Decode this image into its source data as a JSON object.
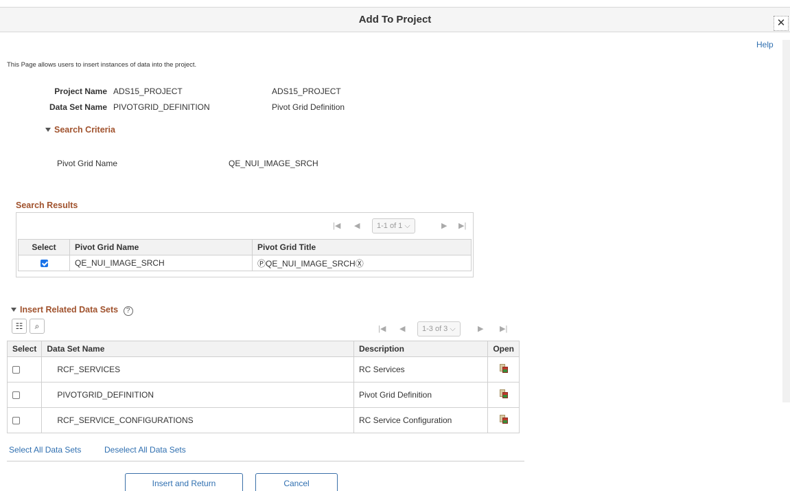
{
  "dialog": {
    "title": "Add To Project",
    "close_label": "✕"
  },
  "help_label": "Help",
  "intro": "This Page allows users to insert instances of data into the project.",
  "fields": {
    "project_label": "Project Name",
    "project_value": "ADS15_PROJECT",
    "project_desc": "ADS15_PROJECT",
    "dataset_label": "Data Set Name",
    "dataset_value": "PIVOTGRID_DEFINITION",
    "dataset_desc": "Pivot Grid Definition"
  },
  "search_criteria": {
    "header": "Search Criteria",
    "field_label": "Pivot Grid Name",
    "field_value": "QE_NUI_IMAGE_SRCH"
  },
  "search_results": {
    "header": "Search Results",
    "pager": {
      "first": "|◀",
      "prev": "◀",
      "label": "1-1 of 1",
      "next": "▶",
      "last": "▶|"
    },
    "columns": [
      "Select",
      "Pivot Grid Name",
      "Pivot Grid Title"
    ],
    "rows": [
      {
        "checked": true,
        "name": "QE_NUI_IMAGE_SRCH",
        "title": "ⓅQE_NUI_IMAGE_SRCHⓍ"
      }
    ]
  },
  "related": {
    "header": "Insert Related Data Sets",
    "help_icon": "?",
    "pager": {
      "first": "|◀",
      "prev": "◀",
      "label": "1-3 of 3",
      "next": "▶",
      "last": "▶|"
    },
    "columns": [
      "Select",
      "Data Set Name",
      "Description",
      "Open"
    ],
    "rows": [
      {
        "name": "RCF_SERVICES",
        "description": "RC Services"
      },
      {
        "name": "PIVOTGRID_DEFINITION",
        "description": "Pivot Grid Definition"
      },
      {
        "name": "RCF_SERVICE_CONFIGURATIONS",
        "description": "RC Service Configuration"
      }
    ]
  },
  "links": {
    "select_all": "Select All Data Sets",
    "deselect_all": "Deselect All Data Sets"
  },
  "buttons": {
    "insert": "Insert and Return",
    "cancel": "Cancel"
  },
  "colors": {
    "accent": "#2f6fb0",
    "section_header": "#a0522d",
    "checkbox_on": "#1a73e8"
  }
}
